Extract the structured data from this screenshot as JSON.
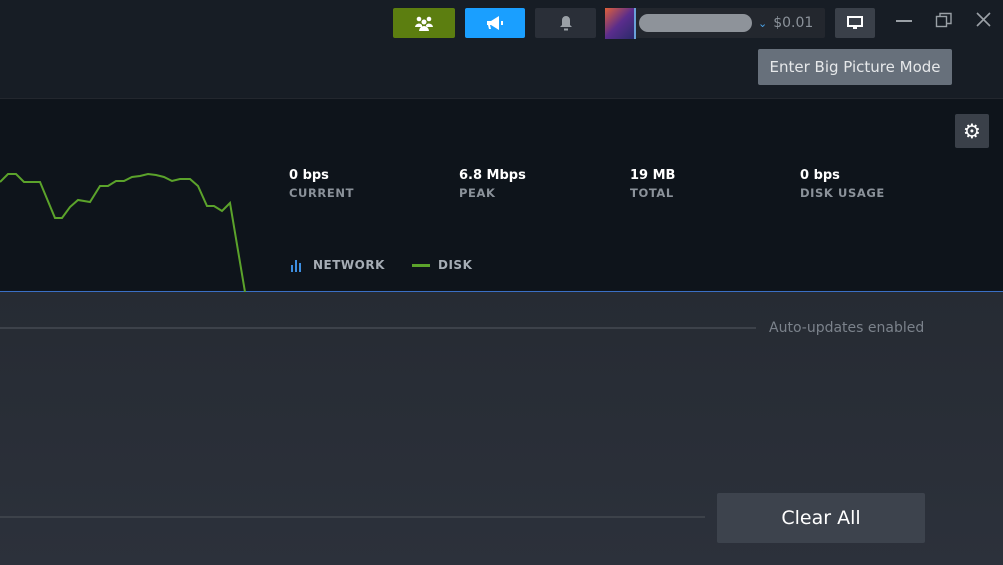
{
  "header": {
    "balance": "$0.01",
    "tooltip": "Enter Big Picture Mode"
  },
  "stats": [
    {
      "value": "0 bps",
      "label": "CURRENT"
    },
    {
      "value": "6.8 Mbps",
      "label": "PEAK"
    },
    {
      "value": "19 MB",
      "label": "TOTAL"
    },
    {
      "value": "0 bps",
      "label": "DISK USAGE"
    }
  ],
  "legend": {
    "network": "NETWORK",
    "disk": "DISK"
  },
  "colors": {
    "friends": "#5c7e10",
    "announce": "#1a9fff",
    "disk": "#5ba32b",
    "network": "#3d8ee0"
  },
  "downloads": {
    "auto_updates": "Auto-updates enabled",
    "clear_all": "Clear All"
  }
}
